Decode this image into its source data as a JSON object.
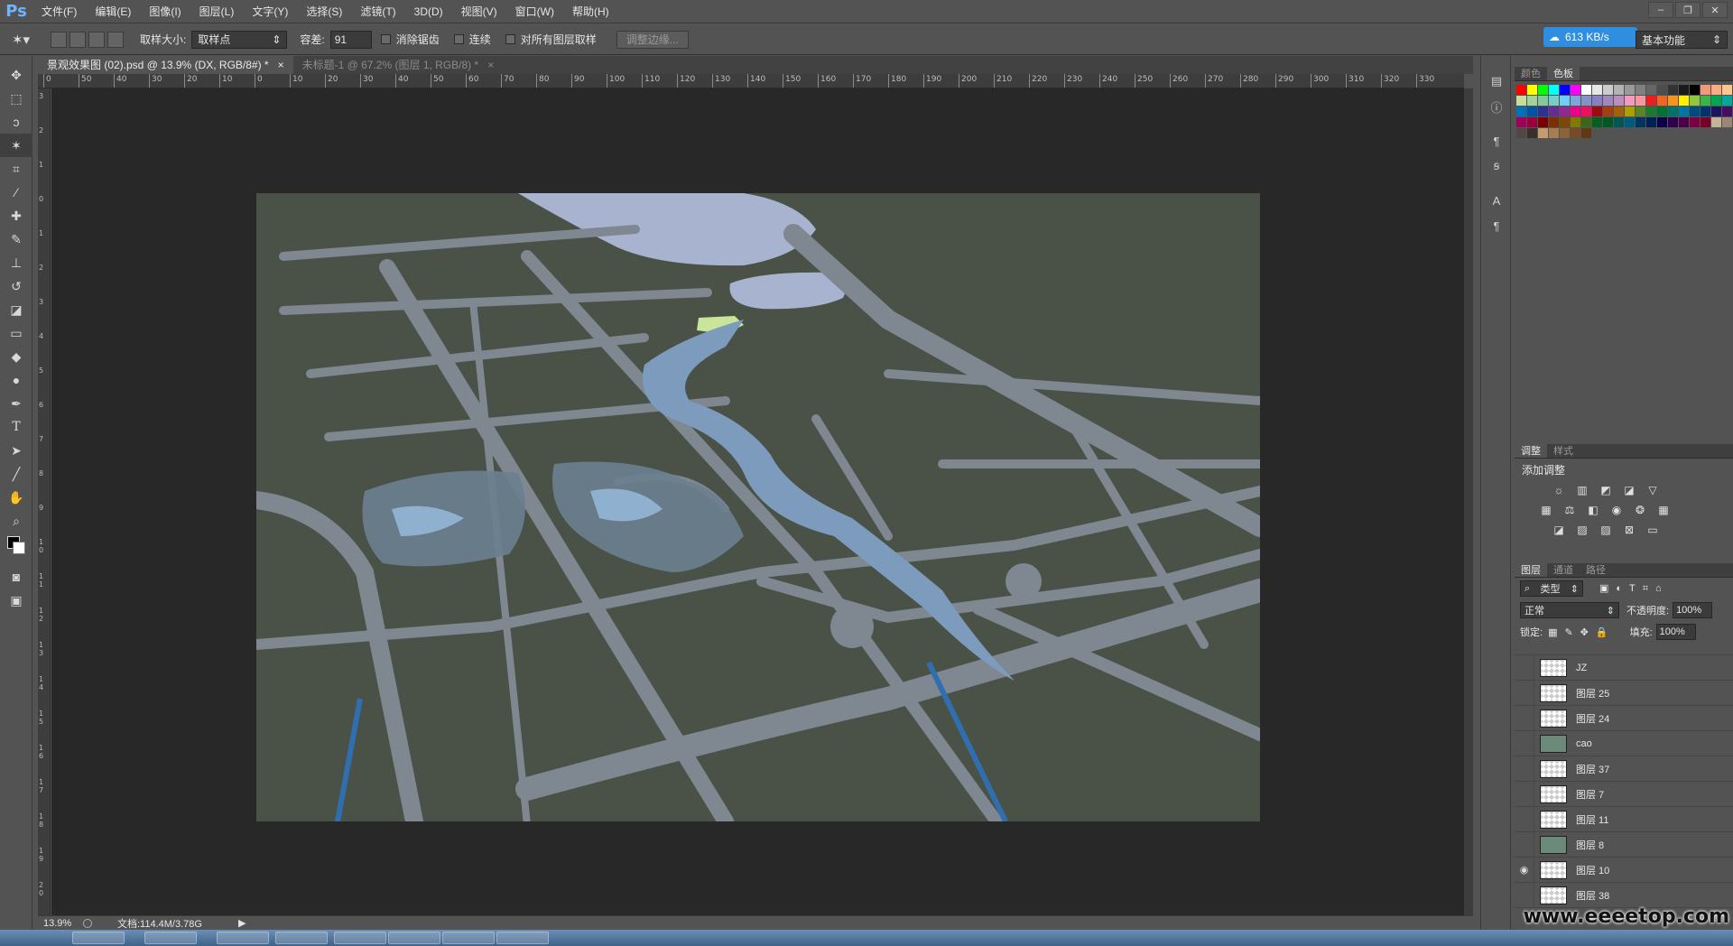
{
  "app": {
    "logo": "Ps"
  },
  "menus": [
    "文件(F)",
    "编辑(E)",
    "图像(I)",
    "图层(L)",
    "文字(Y)",
    "选择(S)",
    "滤镜(T)",
    "3D(D)",
    "视图(V)",
    "窗口(W)",
    "帮助(H)"
  ],
  "options": {
    "sample_size_label": "取样大小:",
    "sample_size_value": "取样点",
    "tolerance_label": "容差:",
    "tolerance_value": "91",
    "antialias_label": "消除锯齿",
    "contiguous_label": "连续",
    "all_layers_label": "对所有图层取样",
    "refine_edge_label": "调整边缘...",
    "speed": "613 KB/s",
    "workspace": "基本功能"
  },
  "tabs": [
    {
      "label": "景观效果图 (02).psd @ 13.9% (DX, RGB/8#) *",
      "close": "×"
    },
    {
      "label": "未标题-1 @ 67.2% (图层 1, RGB/8) *",
      "close": "×"
    }
  ],
  "ruler_top": [
    "0",
    "50",
    "40",
    "30",
    "20",
    "10",
    "0",
    "10",
    "20",
    "30",
    "40",
    "50",
    "60",
    "70",
    "80",
    "90",
    "100",
    "110",
    "120",
    "130",
    "140",
    "150",
    "160",
    "170",
    "180",
    "190",
    "200",
    "210",
    "220",
    "230",
    "240",
    "250",
    "260",
    "270",
    "280",
    "290",
    "300",
    "310",
    "320",
    "330"
  ],
  "ruler_left": [
    "3",
    "2",
    "1",
    "0",
    "1",
    "2",
    "3",
    "4",
    "5",
    "6",
    "7",
    "8",
    "9",
    "10",
    "11",
    "12",
    "13",
    "14",
    "15",
    "16",
    "17",
    "18",
    "19",
    "20"
  ],
  "status": {
    "zoom": "13.9%",
    "doc": "文档:114.4M/3.78G"
  },
  "panels": {
    "color_tab": "颜色",
    "swatches_tab": "色板",
    "adjust_tab": "调整",
    "styles_tab": "样式",
    "adjust_title": "添加调整",
    "layers_tab": "图层",
    "channels_tab": "通道",
    "paths_tab": "路径",
    "filter_kind": "类型",
    "blend_mode": "正常",
    "opacity_label": "不透明度:",
    "opacity_value": "100%",
    "lock_label": "锁定:",
    "fill_label": "填充:",
    "fill_value": "100%"
  },
  "layers": [
    {
      "name": "JZ",
      "visible": false,
      "thumb": "empty"
    },
    {
      "name": "图层 25",
      "visible": false,
      "thumb": "empty"
    },
    {
      "name": "图层 24",
      "visible": false,
      "thumb": "empty"
    },
    {
      "name": "cao",
      "visible": false,
      "thumb": "image"
    },
    {
      "name": "图层 37",
      "visible": false,
      "thumb": "empty"
    },
    {
      "name": "图层 7",
      "visible": false,
      "thumb": "empty"
    },
    {
      "name": "图层 11",
      "visible": false,
      "thumb": "empty"
    },
    {
      "name": "图层 8",
      "visible": false,
      "thumb": "image"
    },
    {
      "name": "图层 10",
      "visible": true,
      "thumb": "empty"
    },
    {
      "name": "图层 38",
      "visible": false,
      "thumb": "empty"
    }
  ],
  "watermark": "www.eeeetop.com",
  "colors": {
    "ui_bg": "#535353",
    "canvas_bg": "#282828",
    "art_bg": "#4a5247",
    "road": "#7f8790",
    "water": "#a8b3cf",
    "river": "#7d9bbd",
    "accent": "#2f8ee0"
  },
  "swatches": [
    "#ff0000",
    "#ffff00",
    "#00ff00",
    "#00ffff",
    "#0000ff",
    "#ff00ff",
    "#ffffff",
    "#e6e6e6",
    "#cccccc",
    "#b3b3b3",
    "#999999",
    "#808080",
    "#666666",
    "#4d4d4d",
    "#333333",
    "#1a1a1a",
    "#000000",
    "#f7977a",
    "#fbad82",
    "#fdc68c",
    "#fff799",
    "#c4df9b",
    "#a3d39c",
    "#82ca9c",
    "#7accc8",
    "#6dcff6",
    "#7da7d9",
    "#8493ca",
    "#8781bd",
    "#a187be",
    "#bc8dbf",
    "#f49ac1",
    "#f5989d",
    "#ee1d24",
    "#f16522",
    "#f7941d",
    "#fff100",
    "#8fc63d",
    "#37b44a",
    "#00a650",
    "#00a99e",
    "#00aeef",
    "#0072bc",
    "#0054a5",
    "#2f3192",
    "#652c91",
    "#91278f",
    "#ed008c",
    "#ee105a",
    "#9d0a0f",
    "#a1410d",
    "#a36209",
    "#aba000",
    "#588528",
    "#197b30",
    "#007236",
    "#00736a",
    "#0076a4",
    "#004a80",
    "#003370",
    "#1d1363",
    "#450e61",
    "#62055f",
    "#9e005c",
    "#9d0039",
    "#790000",
    "#7b3000",
    "#7c4900",
    "#827a00",
    "#3e6617",
    "#045f20",
    "#005824",
    "#005951",
    "#005b7e",
    "#003562",
    "#002056",
    "#0c004b",
    "#30004a",
    "#4b0048",
    "#7a0045",
    "#7a0026",
    "#c7b299",
    "#998675",
    "#736357",
    "#534741",
    "#37302d",
    "#c69c6d",
    "#a67c52",
    "#8c6239",
    "#754c24",
    "#603813"
  ]
}
